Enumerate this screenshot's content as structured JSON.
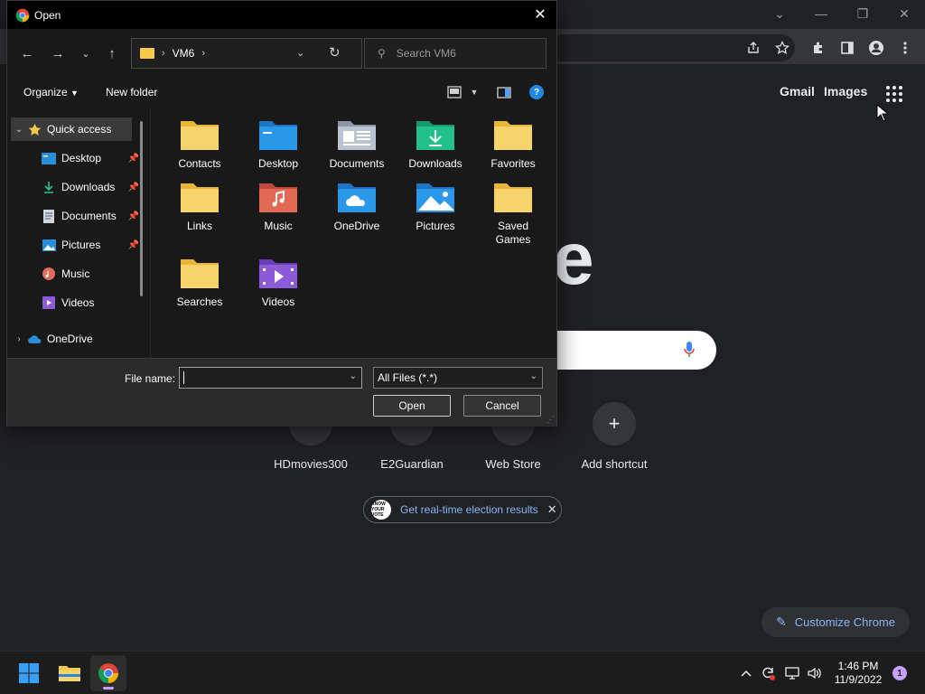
{
  "dialog": {
    "title": "Open",
    "address": {
      "crumb": "VM6"
    },
    "search_placeholder": "Search VM6",
    "commands": {
      "organize": "Organize",
      "new_folder": "New folder"
    },
    "nav_items": [
      {
        "label": "Quick access",
        "pinned": false
      },
      {
        "label": "Desktop",
        "pinned": true
      },
      {
        "label": "Downloads",
        "pinned": true
      },
      {
        "label": "Documents",
        "pinned": true
      },
      {
        "label": "Pictures",
        "pinned": true
      },
      {
        "label": "Music",
        "pinned": false
      },
      {
        "label": "Videos",
        "pinned": false
      },
      {
        "label": "OneDrive",
        "pinned": false
      }
    ],
    "folders": [
      "Contacts",
      "Desktop",
      "Documents",
      "Downloads",
      "Favorites",
      "Links",
      "Music",
      "OneDrive",
      "Pictures",
      "Saved Games",
      "Searches",
      "Videos"
    ],
    "file_name_label": "File name:",
    "file_name_value": "",
    "file_type": "All Files (*.*)",
    "open_label": "Open",
    "cancel_label": "Cancel"
  },
  "chrome": {
    "links": {
      "gmail": "Gmail",
      "images": "Images"
    },
    "logo_fragment": "e",
    "shortcuts": [
      {
        "label": "HDmovies300"
      },
      {
        "label": "E2Guardian"
      },
      {
        "label": "Web Store"
      },
      {
        "label": "Add shortcut"
      }
    ],
    "promo_text": "Get real-time election results",
    "promo_badge": "KNOW YOUR VOTE",
    "customize_label": "Customize Chrome"
  },
  "taskbar": {
    "time": "1:46 PM",
    "date": "11/9/2022",
    "notification_count": "1"
  },
  "colors": {
    "accent": "#8ab4f8",
    "folder_yellow": "#f5c94a",
    "help_blue": "#1e88e5",
    "taskbar_pip": "#c5a3ff"
  }
}
